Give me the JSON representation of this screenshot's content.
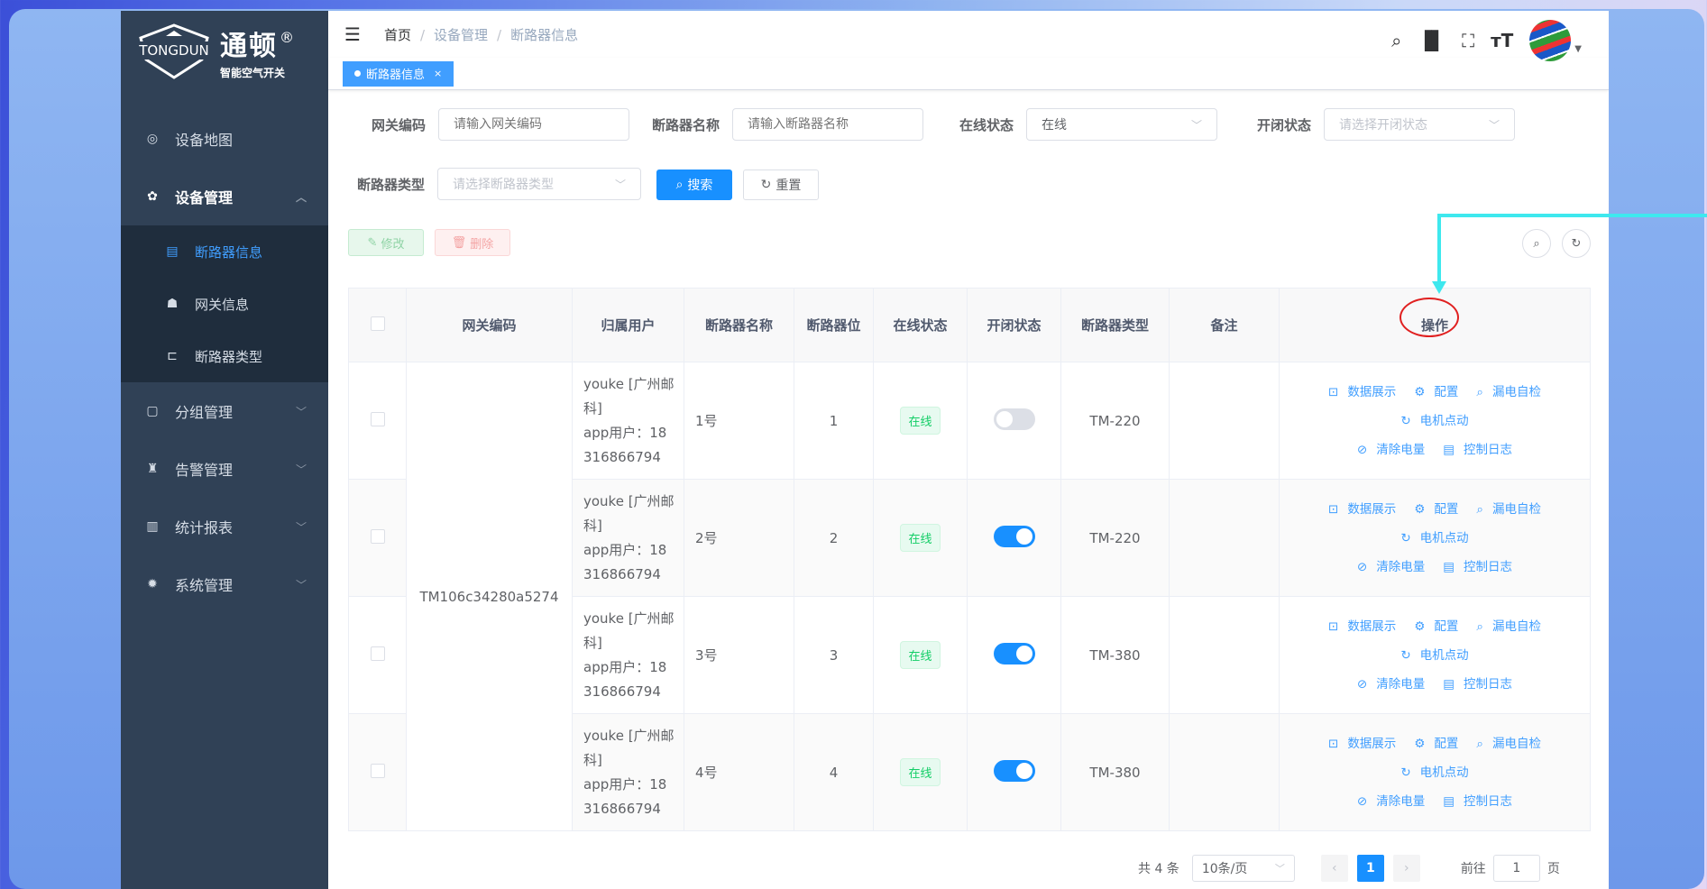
{
  "brand": {
    "name_en": "TONGDUN",
    "name_cn": "通顿",
    "reg": "®",
    "sub": "智能空气开关"
  },
  "sidebar": {
    "items": [
      {
        "label": "设备地图",
        "icon": "location-icon"
      },
      {
        "label": "设备管理",
        "icon": "gear-icon",
        "open": true,
        "children": [
          {
            "label": "断路器信息",
            "icon": "document-icon",
            "active": true
          },
          {
            "label": "网关信息",
            "icon": "router-icon"
          },
          {
            "label": "断路器类型",
            "icon": "tree-icon"
          }
        ]
      },
      {
        "label": "分组管理",
        "icon": "folder-icon"
      },
      {
        "label": "告警管理",
        "icon": "alarm-icon"
      },
      {
        "label": "统计报表",
        "icon": "chart-icon"
      },
      {
        "label": "系统管理",
        "icon": "settings-icon"
      }
    ]
  },
  "breadcrumb": [
    "首页",
    "设备管理",
    "断路器信息"
  ],
  "tags": [
    {
      "label": "断路器信息",
      "close": "×"
    }
  ],
  "filters": {
    "gateway_code": {
      "label": "网关编码",
      "placeholder": "请输入网关编码"
    },
    "breaker_name": {
      "label": "断路器名称",
      "placeholder": "请输入断路器名称"
    },
    "online_status": {
      "label": "在线状态",
      "value": "在线"
    },
    "switch_status": {
      "label": "开闭状态",
      "placeholder": "请选择开闭状态"
    },
    "breaker_type": {
      "label": "断路器类型",
      "placeholder": "请选择断路器类型"
    },
    "search_label": "搜索",
    "reset_label": "重置"
  },
  "toolbar": {
    "edit_label": "修改",
    "delete_label": "删除"
  },
  "table": {
    "headers": [
      "网关编码",
      "归属用户",
      "断路器名称",
      "断路器位",
      "在线状态",
      "开闭状态",
      "断路器类型",
      "备注",
      "操作"
    ],
    "gateway": "TM106c34280a5274",
    "rows": [
      {
        "user": [
          "youke [广州邮",
          "科]",
          "app用户：18",
          "316866794"
        ],
        "name": "1号",
        "pos": "1",
        "online": "在线",
        "switch_on": false,
        "type": "TM-220",
        "remark": ""
      },
      {
        "user": [
          "youke [广州邮",
          "科]",
          "app用户：18",
          "316866794"
        ],
        "name": "2号",
        "pos": "2",
        "online": "在线",
        "switch_on": true,
        "type": "TM-220",
        "remark": ""
      },
      {
        "user": [
          "youke [广州邮",
          "科]",
          "app用户：18",
          "316866794"
        ],
        "name": "3号",
        "pos": "3",
        "online": "在线",
        "switch_on": true,
        "type": "TM-380",
        "remark": ""
      },
      {
        "user": [
          "youke [广州邮",
          "科]",
          "app用户：18",
          "316866794"
        ],
        "name": "4号",
        "pos": "4",
        "online": "在线",
        "switch_on": true,
        "type": "TM-380",
        "remark": ""
      }
    ],
    "ops": {
      "data": "数据展示",
      "config": "配置",
      "leak": "漏电自检",
      "motor": "电机点动",
      "clear": "清除电量",
      "log": "控制日志"
    }
  },
  "pager": {
    "total": "共 4 条",
    "size": "10条/页",
    "current": "1",
    "goto": "前往",
    "goto_value": "1",
    "page_unit": "页"
  },
  "colors": {
    "sidebar_bg": "#304156",
    "primary": "#1890ff",
    "online_green": "#13ce66",
    "annotation_red": "#e02020",
    "annotation_cyan": "#3ee8ee"
  }
}
